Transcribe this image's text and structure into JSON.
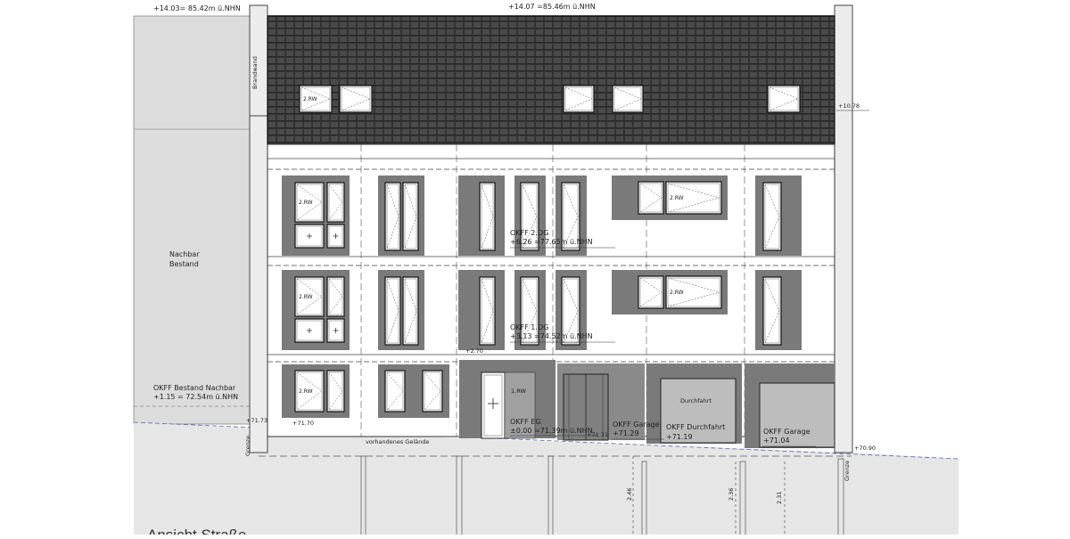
{
  "title": "Ansicht Straße",
  "neighbor": {
    "line1": "Nachbar",
    "line2": "Bestand"
  },
  "levels": {
    "top_left": "+14.03= 85.42m ü.NHN",
    "top_center": "+14.07 =85.46m ü.NHN",
    "eave": "+10.78",
    "og2_label": "OKFF 2.OG",
    "og2_value": "+6.26 =77.65m ü.NHN",
    "og1_label": "OKFF 1.OG",
    "og1_value": "+3.13 =74.52m ü.NHN",
    "eg_label": "OKFF EG",
    "eg_value": "±0.00 =71.39m ü.NHN",
    "neighbor_label": "OKFF Bestand Nachbar",
    "neighbor_value": "+1.15 = 72.54m ü.NHN",
    "garage1_label": "OKFF Garage",
    "garage1_value": "+71.29",
    "durchfahrt_label": "OKFF Durchfahrt",
    "durchfahrt_value": "+71.19",
    "garage2_label": "OKFF Garage",
    "garage2_value": "+71.04",
    "step": "+2.70",
    "ground_left1": "+71.73",
    "ground_left2": "+71.70",
    "ground_mid": "+71.31",
    "ground_right": "+70.90"
  },
  "tags": {
    "rw2": "2.RW",
    "rw1": "1.RW",
    "durchfahrt": "Durchfahrt",
    "brandwand": "Brandwand",
    "gelaende": "vorhandenes Gelände",
    "grenze": "Grenze"
  },
  "dims": {
    "d1": "2.46",
    "d2": "2.36",
    "d3": "2.31"
  },
  "colors": {
    "roof": "#3a3a3a",
    "surround": "#7a7a7a",
    "neighbor": "#dcdcdc",
    "ground": "#e6e6e6"
  }
}
